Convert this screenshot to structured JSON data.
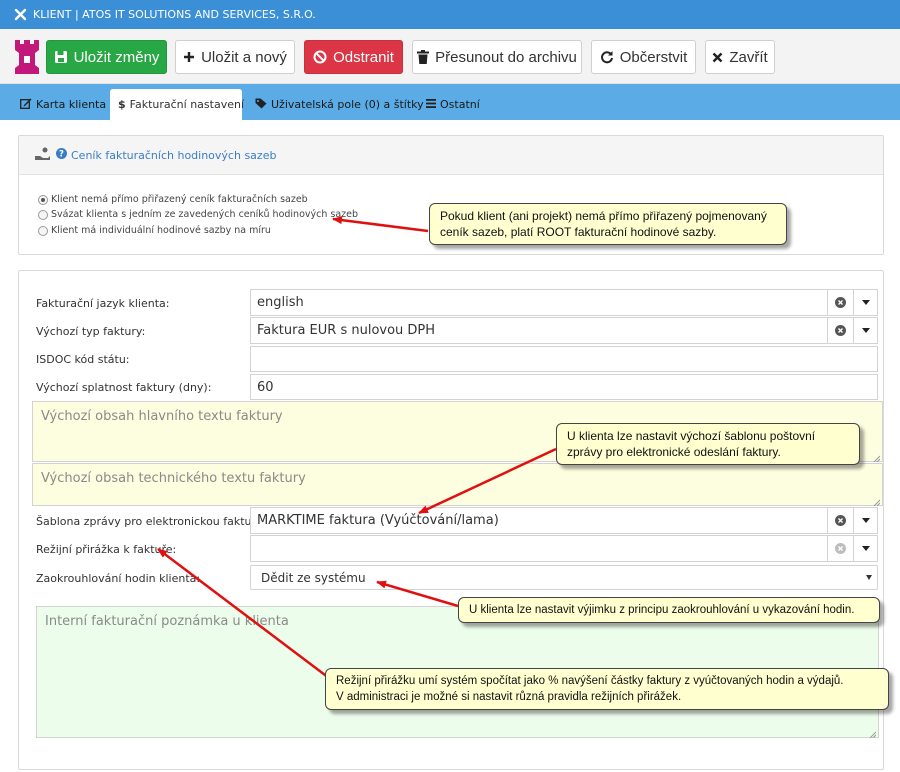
{
  "window": {
    "title": "KLIENT | ATOS IT SOLUTIONS AND SERVICES, S.R.O."
  },
  "toolbar": {
    "save_label": "Uložit změny",
    "save_new_label": "Uložit a nový",
    "delete_label": "Odstranit",
    "archive_label": "Přesunout do archivu",
    "refresh_label": "Občerstvit",
    "close_label": "Zavřít"
  },
  "tabs": [
    {
      "label": "Karta klienta",
      "icon": "edit-icon"
    },
    {
      "label": "Fakturační nastavení",
      "icon": "dollar-icon",
      "active": true
    },
    {
      "label": "Uživatelská pole (0) a štítky",
      "icon": "tag-icon"
    },
    {
      "label": "Ostatní",
      "icon": "list-icon"
    }
  ],
  "rates_panel": {
    "title": "Ceník fakturačních hodinových sazeb",
    "options": [
      {
        "label": "Klient nemá přímo přiřazený ceník fakturačních sazeb",
        "selected": true
      },
      {
        "label": "Svázat klienta s jedním ze zavedených ceníků hodinových sazeb",
        "selected": false
      },
      {
        "label": "Klient má individuální hodinové sazby na míru",
        "selected": false
      }
    ]
  },
  "form": {
    "language": {
      "label": "Fakturační jazyk klienta:",
      "value": "english"
    },
    "invoice_type": {
      "label": "Výchozí typ faktury:",
      "value": "Faktura EUR s nulovou DPH"
    },
    "isdoc": {
      "label": "ISDOC kód státu:",
      "value": ""
    },
    "due_days": {
      "label": "Výchozí splatnost faktury (dny):",
      "value": "60"
    },
    "main_text": {
      "placeholder": "Výchozí obsah hlavního textu faktury"
    },
    "tech_text": {
      "placeholder": "Výchozí obsah technického textu faktury"
    },
    "email_template": {
      "label": "Šablona zprávy pro elektronickou fakturaci:",
      "value": "MARKTIME faktura (Vyúčtování/lama)"
    },
    "overhead": {
      "label": "Režijní přirážka k faktuře:",
      "value": ""
    },
    "rounding": {
      "label": "Zaokrouhlování hodin klienta:",
      "value": "Dědit ze systému"
    },
    "note": {
      "placeholder": "Interní fakturační poznámka u klienta"
    }
  },
  "callouts": {
    "rates": [
      "Pokud klient (ani projekt) nemá přímo přiřazený pojmenovaný",
      "ceník sazeb, platí ROOT fakturační hodinové sazby."
    ],
    "template": [
      "U klienta lze nastavit výchozí šablonu poštovní",
      "zprávy pro elektronické odeslání faktury."
    ],
    "rounding": [
      "U klienta lze nastavit výjimku z principu zaokrouhlování u vykazování hodin."
    ],
    "overhead": [
      "Režijní přirážku umí systém spočítat jako % navýšení částky faktury z vyúčtovaných hodin a výdajů.",
      "V administraci je možné si nastavit různá pravidla režijních přirážek."
    ]
  },
  "colors": {
    "titlebar": "#3a8fd6",
    "tabbar": "#5aabe6",
    "success": "#28a745",
    "danger": "#dc3545",
    "callout_bg": "#ffffd0",
    "arrow": "#e01010"
  }
}
